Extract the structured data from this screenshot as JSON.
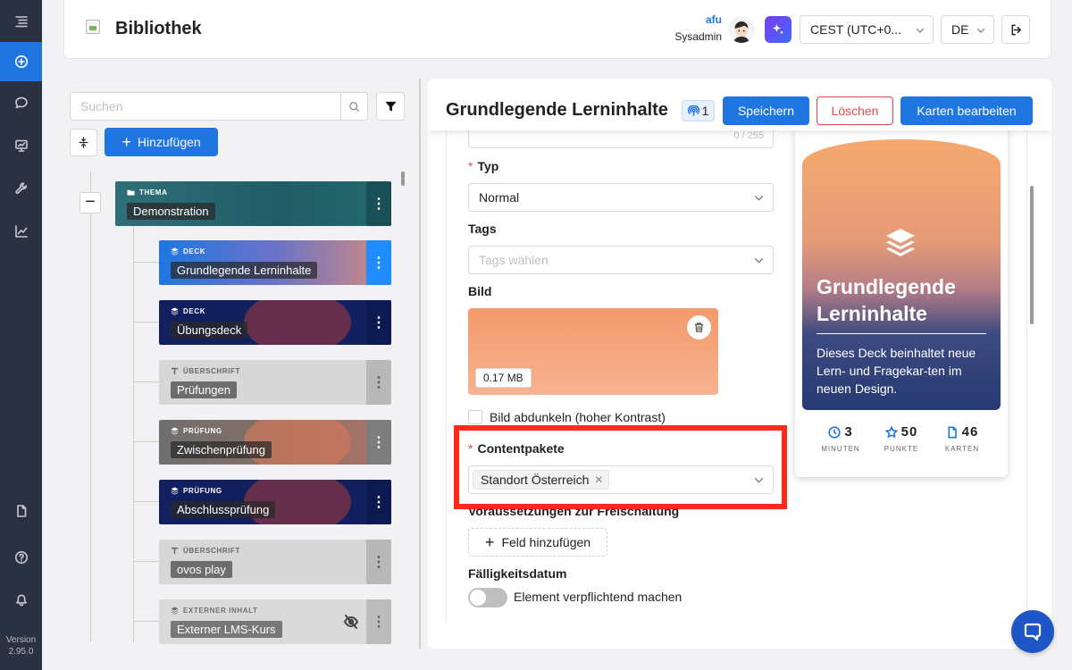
{
  "app": {
    "version_label": "Version",
    "version_number": "2.95.0"
  },
  "header": {
    "title": "Bibliothek",
    "user_name": "afu",
    "user_role": "Sysadmin",
    "timezone": "CEST (UTC+0...",
    "language": "DE"
  },
  "tree": {
    "search_placeholder": "Suchen",
    "add_label": "Hinzufügen",
    "nodes": [
      {
        "type": "THEMA",
        "label": "Demonstration"
      },
      {
        "type": "DECK",
        "label": "Grundlegende Lerninhalte"
      },
      {
        "type": "DECK",
        "label": "Übungsdeck"
      },
      {
        "type": "ÜBERSCHRIFT",
        "label": "Prüfungen"
      },
      {
        "type": "PRÜFUNG",
        "label": "Zwischenprüfung"
      },
      {
        "type": "PRÜFUNG",
        "label": "Abschlussprüfung"
      },
      {
        "type": "ÜBERSCHRIFT",
        "label": "ovos play"
      },
      {
        "type": "EXTERNER INHALT",
        "label": "Externer LMS-Kurs"
      }
    ]
  },
  "detail": {
    "title": "Grundlegende Lerninhalte",
    "podcast_count": "1",
    "save_label": "Speichern",
    "delete_label": "Löschen",
    "edit_cards_label": "Karten bearbeiten",
    "char_count": "0 / 255",
    "type_label": "Typ",
    "type_value": "Normal",
    "tags_label": "Tags",
    "tags_placeholder": "Tags wählen",
    "image_label": "Bild",
    "image_size": "0.17 MB",
    "darken_label": "Bild abdunkeln (hoher Kontrast)",
    "content_packages_label": "Contentpakete",
    "content_package_tag": "Standort Österreich",
    "prerequisites_label": "Voraussetzungen zur Freischaltung",
    "add_field_label": "Feld hinzufügen",
    "due_date_label": "Fälligkeitsdatum",
    "mandatory_label": "Element verpflichtend machen"
  },
  "preview": {
    "title": "Grundlegende Lerninhalte",
    "description": "Dieses Deck beinhaltet neue Lern- und Fragekar-ten im neuen Design.",
    "stats": [
      {
        "value": "3",
        "label": "MINUTEN",
        "icon": "clock-icon"
      },
      {
        "value": "50",
        "label": "PUNKTE",
        "icon": "star-icon"
      },
      {
        "value": "46",
        "label": "KARTEN",
        "icon": "file-icon"
      }
    ]
  },
  "colors": {
    "accent": "#1f76e0",
    "danger": "#e54848",
    "highlight": "#ff2a1a",
    "rail": "#2a3140"
  }
}
